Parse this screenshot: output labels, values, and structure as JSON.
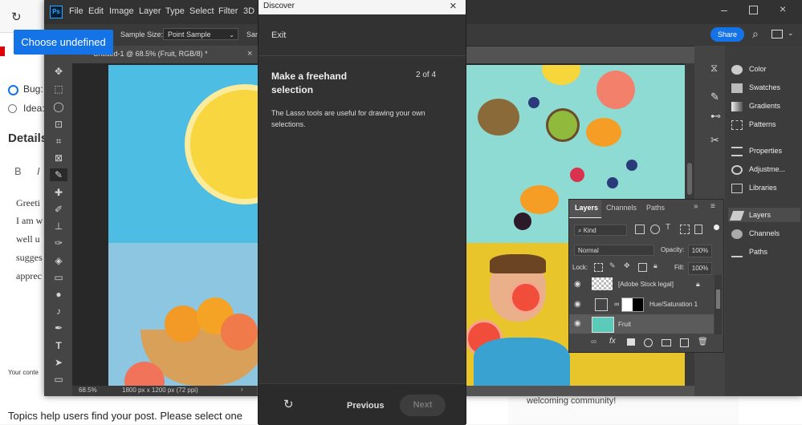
{
  "colors": {
    "accent": "#1473e6",
    "ps_bg": "#535353",
    "dialog_bg": "#323232"
  },
  "background_page": {
    "radio_options": [
      "Bug:",
      "Idea:"
    ],
    "details_heading": "Details",
    "format_buttons": [
      "B",
      "I"
    ],
    "body_lines": [
      "Greeti",
      "I am w",
      "well u",
      "sugges",
      "apprec"
    ],
    "your_content_note": "Your conte",
    "bottom_prompt": "Topics help users find your post. Please select one",
    "right_bottom_text": "welcoming community!"
  },
  "choose_tooltip": "Choose undefined",
  "photoshop": {
    "logo": "Ps",
    "menu": [
      "File",
      "Edit",
      "Image",
      "Layer",
      "Type",
      "Select",
      "Filter",
      "3D"
    ],
    "options_bar": {
      "sample_size_label": "Sample Size:",
      "sample_size_value": "Point Sample",
      "sample_label_2": "Sam"
    },
    "doc_tab": "Untitled-1 @ 68.5% (Fruit, RGB/8) *",
    "share_label": "Share",
    "status": {
      "zoom": "68.5%",
      "dimensions": "1800 px x 1200 px (72 ppi)"
    },
    "right_panels": [
      {
        "icon": "color-icon",
        "label": "Color"
      },
      {
        "icon": "swatches-icon",
        "label": "Swatches"
      },
      {
        "icon": "gradients-icon",
        "label": "Gradients"
      },
      {
        "icon": "patterns-icon",
        "label": "Patterns"
      },
      {
        "icon": "properties-icon",
        "label": "Properties"
      },
      {
        "icon": "adjustments-icon",
        "label": "Adjustme..."
      },
      {
        "icon": "libraries-icon",
        "label": "Libraries"
      },
      {
        "icon": "layers-icon",
        "label": "Layers"
      },
      {
        "icon": "channels-icon",
        "label": "Channels"
      },
      {
        "icon": "paths-icon",
        "label": "Paths"
      }
    ],
    "layers_panel": {
      "tabs": [
        "Layers",
        "Channels",
        "Paths"
      ],
      "kind_label": "Kind",
      "blend_mode": "Normal",
      "opacity_label": "Opacity:",
      "opacity_value": "100%",
      "lock_label": "Lock:",
      "fill_label": "Fill:",
      "fill_value": "100%",
      "layers": [
        "[Adobe Stock legal]",
        "Hue/Saturation 1",
        "Fruit"
      ]
    }
  },
  "discover": {
    "title": "Discover",
    "exit_label": "Exit",
    "heading": "Make a freehand selection",
    "step": "2 of 4",
    "description": "The Lasso tools are useful for drawing your own selections.",
    "previous_label": "Previous",
    "next_label": "Next"
  }
}
